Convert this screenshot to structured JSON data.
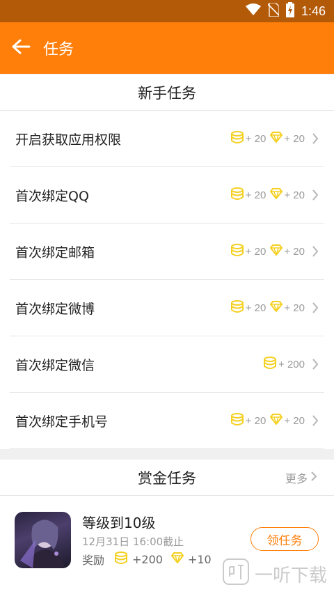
{
  "status_bar": {
    "time": "1:46"
  },
  "app_bar": {
    "title": "任务"
  },
  "newbie": {
    "title": "新手任务",
    "tasks": [
      {
        "name": "开启获取应用权限",
        "coin": "+ 20",
        "gem": "+ 20"
      },
      {
        "name": "首次绑定QQ",
        "coin": "+ 20",
        "gem": "+ 20"
      },
      {
        "name": "首次绑定邮箱",
        "coin": "+ 20",
        "gem": "+ 20"
      },
      {
        "name": "首次绑定微博",
        "coin": "+ 20",
        "gem": "+ 20"
      },
      {
        "name": "首次绑定微信",
        "coin": "+ 200"
      },
      {
        "name": "首次绑定手机号",
        "coin": "+ 20",
        "gem": "+ 20"
      }
    ]
  },
  "bounty": {
    "title": "赏金任务",
    "more": "更多",
    "item": {
      "title": "等级到10级",
      "deadline": "12月31日 16:00截止",
      "reward_label": "奖励",
      "coin": "+200",
      "gem": "+10",
      "button": "领任务"
    }
  },
  "watermark": {
    "text": "一听下载"
  },
  "colors": {
    "accent": "#ff7f0a",
    "status_bar": "#b35a08",
    "coin": "#f5d020",
    "gem": "#f5d020"
  }
}
